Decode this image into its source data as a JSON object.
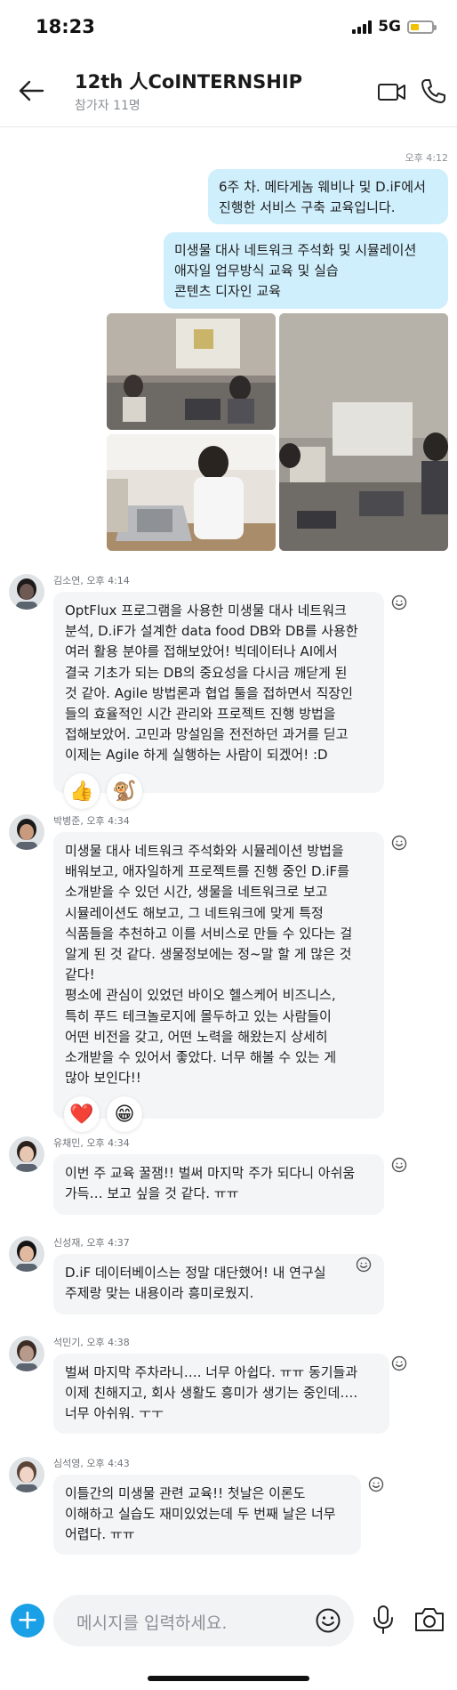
{
  "status": {
    "time": "18:23",
    "network": "5G"
  },
  "header": {
    "title": "12th 人CoINTERNSHIP",
    "subtitle": "참가자 11명"
  },
  "outgoing": {
    "time": "오후 4:12",
    "messages": [
      "6주 차. 메타게놈 웨비나 및 D.iF에서\n진행한 서비스 구축 교육입니다.",
      "미생물 대사 네트워크 주석화 및 시뮬레이션\n애자일 업무방식 교육 및 실습\n콘텐츠 디자인 교육"
    ]
  },
  "messages": [
    {
      "meta": "김소연, 오후 4:14",
      "text": "OptFlux 프로그램을 사용한 미생물 대사 네트워크\n분석, D.iF가 설계한 data food DB와 DB를 사용한\n여러 활용 분야를 접해보았어! 빅데이터나 AI에서\n결국 기초가 되는 DB의 중요성을 다시금 깨닫게 된\n것 같아. Agile 방법론과 협업 툴을 접하면서 직장인\n들의 효율적인 시간 관리와 프로젝트 진행 방법을\n접해보았어. 고민과 망설임을 전전하던 과거를 딛고\n이제는 Agile 하게 실행하는 사람이 되겠어! :D",
      "reactions": [
        "👍",
        "🐒"
      ]
    },
    {
      "meta": "박병준, 오후 4:34",
      "text": "미생물 대사 네트워크 주석화와 시뮬레이션 방법을\n배워보고, 애자일하게 프로젝트를 진행 중인 D.iF를\n소개받을 수 있던 시간, 생물을 네트워크로 보고\n시뮬레이션도 해보고, 그 네트워크에 맞게 특정\n식품들을 추천하고 이를 서비스로 만들 수 있다는 걸\n알게 된 것 같다. 생물정보에는 정~말 할 게 많은 것\n같다!\n평소에 관심이 있었던 바이오 헬스케어 비즈니스,\n특히 푸드 테크놀로지에 몰두하고 있는 사람들이\n어떤 비전을 갖고, 어떤 노력을 해왔는지 상세히\n소개받을 수 있어서 좋았다. 너무 해볼 수 있는 게\n많아 보인다!!",
      "reactions": [
        "❤️",
        "😁"
      ]
    },
    {
      "meta": "유채민, 오후 4:34",
      "text": "이번 주 교육 꿀잼!! 벌써 마지막 주가 되다니 아쉬움\n가득… 보고 싶을 것 같다. ㅠㅠ",
      "reactions": []
    },
    {
      "meta": "신성재, 오후 4:37",
      "text": "D.iF 데이터베이스는 정말 대단했어! 내 연구실\n주제랑 맞는 내용이라 흥미로웠지.",
      "reactions": []
    },
    {
      "meta": "석민기, 오후 4:38",
      "text": "벌써 마지막 주차라니…. 너무 아쉽다. ㅠㅠ 동기들과\n이제 친해지고, 회사 생활도 흥미가 생기는 중인데….\n너무 아쉬워. ㅜㅜ",
      "reactions": []
    },
    {
      "meta": "심석영, 오후 4:43",
      "text": "이틀간의 미생물 관련 교육!! 첫날은 이론도\n이해하고 실습도 재미있었는데 두 번째 날은 너무\n어렵다. ㅠㅠ",
      "reactions": []
    }
  ],
  "composer": {
    "placeholder": "메시지를 입력하세요.",
    "add_label": "+"
  },
  "colors": {
    "accent": "#1aa0e6",
    "outgoing_bubble": "#cfeffd",
    "incoming_bubble": "#f3f5f7"
  }
}
